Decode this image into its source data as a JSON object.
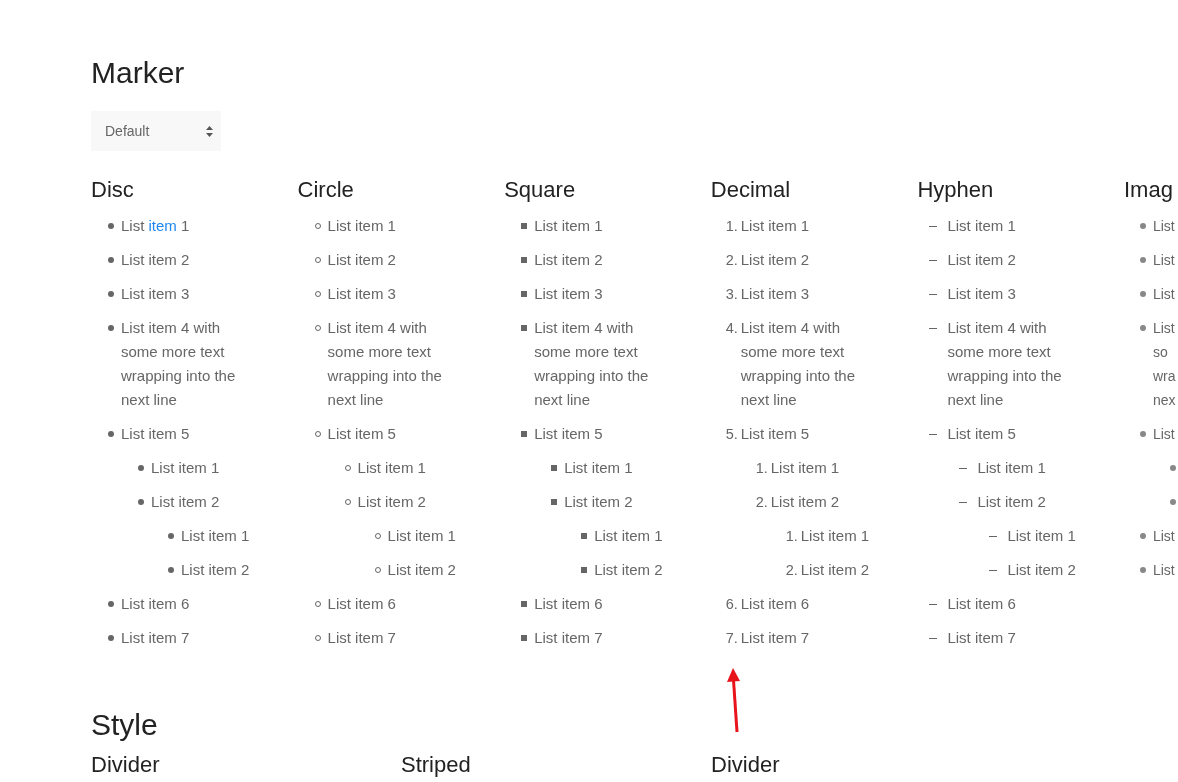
{
  "marker_section": {
    "title": "Marker",
    "select": {
      "value": "Default"
    }
  },
  "columns": [
    {
      "title": "Disc",
      "kind": "disc",
      "items": [
        {
          "text": "List ",
          "link": "item",
          "after": " 1"
        },
        {
          "text": "List item 2"
        },
        {
          "text": "List item 3"
        },
        {
          "text": "List item 4 with some more text wrapping into the next line"
        },
        {
          "text": "List item 5",
          "children": [
            {
              "text": "List item 1"
            },
            {
              "text": "List item 2",
              "children": [
                {
                  "text": "List item 1"
                },
                {
                  "text": "List item 2"
                }
              ]
            }
          ]
        },
        {
          "text": "List item 6"
        },
        {
          "text": "List item 7"
        }
      ]
    },
    {
      "title": "Circle",
      "kind": "circle",
      "items": [
        {
          "text": "List item 1"
        },
        {
          "text": "List item 2"
        },
        {
          "text": "List item 3"
        },
        {
          "text": "List item 4 with some more text wrapping into the next line"
        },
        {
          "text": "List item 5",
          "children": [
            {
              "text": "List item 1"
            },
            {
              "text": "List item 2",
              "children": [
                {
                  "text": "List item 1"
                },
                {
                  "text": "List item 2"
                }
              ]
            }
          ]
        },
        {
          "text": "List item 6"
        },
        {
          "text": "List item 7"
        }
      ]
    },
    {
      "title": "Square",
      "kind": "square",
      "items": [
        {
          "text": "List item 1"
        },
        {
          "text": "List item 2"
        },
        {
          "text": "List item 3"
        },
        {
          "text": "List item 4 with some more text wrapping into the next line"
        },
        {
          "text": "List item 5",
          "children": [
            {
              "text": "List item 1"
            },
            {
              "text": "List item 2",
              "children": [
                {
                  "text": "List item 1"
                },
                {
                  "text": "List item 2"
                }
              ]
            }
          ]
        },
        {
          "text": "List item 6"
        },
        {
          "text": "List item 7"
        }
      ]
    },
    {
      "title": "Decimal",
      "kind": "decimal",
      "items": [
        {
          "number": "1.",
          "text": "List item 1"
        },
        {
          "number": "2.",
          "text": "List item 2"
        },
        {
          "number": "3.",
          "text": "List item 3"
        },
        {
          "number": "4.",
          "text": "List item 4 with some more text wrapping into the next line"
        },
        {
          "number": "5.",
          "text": "List item 5",
          "children": [
            {
              "number": "1.",
              "text": "List item 1"
            },
            {
              "number": "2.",
              "text": "List item 2",
              "children": [
                {
                  "number": "1.",
                  "text": "List item 1"
                },
                {
                  "number": "2.",
                  "text": "List item 2"
                }
              ]
            }
          ]
        },
        {
          "number": "6.",
          "text": "List item 6"
        },
        {
          "number": "7.",
          "text": "List item 7"
        }
      ]
    },
    {
      "title": "Hyphen",
      "kind": "hyphen",
      "items": [
        {
          "text": "List item 1"
        },
        {
          "text": "List item 2"
        },
        {
          "text": "List item 3"
        },
        {
          "text": "List item 4 with some more text wrapping into the next line"
        },
        {
          "text": "List item 5",
          "children": [
            {
              "text": "List item 1"
            },
            {
              "text": "List item 2",
              "children": [
                {
                  "text": "List item 1"
                },
                {
                  "text": "List item 2"
                }
              ]
            }
          ]
        },
        {
          "text": "List item 6"
        },
        {
          "text": "List item 7"
        }
      ]
    },
    {
      "title": "Imag",
      "kind": "image",
      "items": [
        {
          "text": "List"
        },
        {
          "text": "List"
        },
        {
          "text": "List"
        },
        {
          "text": "List so wra nex"
        },
        {
          "text": "List",
          "children": [
            {
              "kind": "marker"
            },
            {
              "kind": "marker"
            }
          ]
        },
        {
          "text": "List"
        },
        {
          "text": "List"
        }
      ]
    }
  ],
  "style_section": {
    "title": "Style",
    "subtitles": [
      "Divider",
      "Striped",
      "Divider"
    ]
  }
}
